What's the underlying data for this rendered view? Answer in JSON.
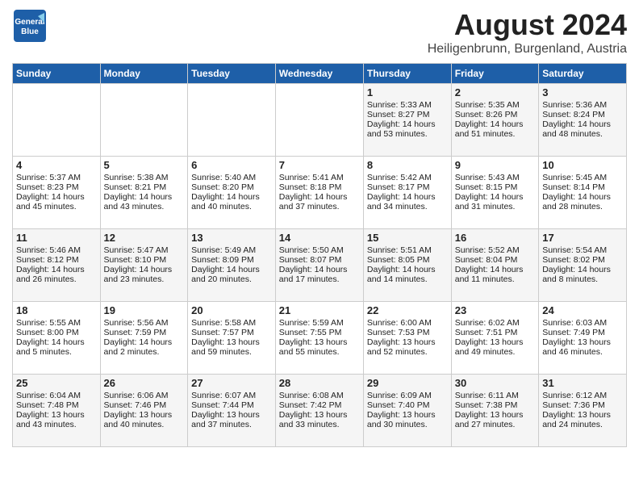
{
  "header": {
    "logo_line1": "General",
    "logo_line2": "Blue",
    "title": "August 2024",
    "subtitle": "Heiligenbrunn, Burgenland, Austria"
  },
  "weekdays": [
    "Sunday",
    "Monday",
    "Tuesday",
    "Wednesday",
    "Thursday",
    "Friday",
    "Saturday"
  ],
  "weeks": [
    [
      {
        "day": "",
        "info": ""
      },
      {
        "day": "",
        "info": ""
      },
      {
        "day": "",
        "info": ""
      },
      {
        "day": "",
        "info": ""
      },
      {
        "day": "1",
        "info": "Sunrise: 5:33 AM\nSunset: 8:27 PM\nDaylight: 14 hours\nand 53 minutes."
      },
      {
        "day": "2",
        "info": "Sunrise: 5:35 AM\nSunset: 8:26 PM\nDaylight: 14 hours\nand 51 minutes."
      },
      {
        "day": "3",
        "info": "Sunrise: 5:36 AM\nSunset: 8:24 PM\nDaylight: 14 hours\nand 48 minutes."
      }
    ],
    [
      {
        "day": "4",
        "info": "Sunrise: 5:37 AM\nSunset: 8:23 PM\nDaylight: 14 hours\nand 45 minutes."
      },
      {
        "day": "5",
        "info": "Sunrise: 5:38 AM\nSunset: 8:21 PM\nDaylight: 14 hours\nand 43 minutes."
      },
      {
        "day": "6",
        "info": "Sunrise: 5:40 AM\nSunset: 8:20 PM\nDaylight: 14 hours\nand 40 minutes."
      },
      {
        "day": "7",
        "info": "Sunrise: 5:41 AM\nSunset: 8:18 PM\nDaylight: 14 hours\nand 37 minutes."
      },
      {
        "day": "8",
        "info": "Sunrise: 5:42 AM\nSunset: 8:17 PM\nDaylight: 14 hours\nand 34 minutes."
      },
      {
        "day": "9",
        "info": "Sunrise: 5:43 AM\nSunset: 8:15 PM\nDaylight: 14 hours\nand 31 minutes."
      },
      {
        "day": "10",
        "info": "Sunrise: 5:45 AM\nSunset: 8:14 PM\nDaylight: 14 hours\nand 28 minutes."
      }
    ],
    [
      {
        "day": "11",
        "info": "Sunrise: 5:46 AM\nSunset: 8:12 PM\nDaylight: 14 hours\nand 26 minutes."
      },
      {
        "day": "12",
        "info": "Sunrise: 5:47 AM\nSunset: 8:10 PM\nDaylight: 14 hours\nand 23 minutes."
      },
      {
        "day": "13",
        "info": "Sunrise: 5:49 AM\nSunset: 8:09 PM\nDaylight: 14 hours\nand 20 minutes."
      },
      {
        "day": "14",
        "info": "Sunrise: 5:50 AM\nSunset: 8:07 PM\nDaylight: 14 hours\nand 17 minutes."
      },
      {
        "day": "15",
        "info": "Sunrise: 5:51 AM\nSunset: 8:05 PM\nDaylight: 14 hours\nand 14 minutes."
      },
      {
        "day": "16",
        "info": "Sunrise: 5:52 AM\nSunset: 8:04 PM\nDaylight: 14 hours\nand 11 minutes."
      },
      {
        "day": "17",
        "info": "Sunrise: 5:54 AM\nSunset: 8:02 PM\nDaylight: 14 hours\nand 8 minutes."
      }
    ],
    [
      {
        "day": "18",
        "info": "Sunrise: 5:55 AM\nSunset: 8:00 PM\nDaylight: 14 hours\nand 5 minutes."
      },
      {
        "day": "19",
        "info": "Sunrise: 5:56 AM\nSunset: 7:59 PM\nDaylight: 14 hours\nand 2 minutes."
      },
      {
        "day": "20",
        "info": "Sunrise: 5:58 AM\nSunset: 7:57 PM\nDaylight: 13 hours\nand 59 minutes."
      },
      {
        "day": "21",
        "info": "Sunrise: 5:59 AM\nSunset: 7:55 PM\nDaylight: 13 hours\nand 55 minutes."
      },
      {
        "day": "22",
        "info": "Sunrise: 6:00 AM\nSunset: 7:53 PM\nDaylight: 13 hours\nand 52 minutes."
      },
      {
        "day": "23",
        "info": "Sunrise: 6:02 AM\nSunset: 7:51 PM\nDaylight: 13 hours\nand 49 minutes."
      },
      {
        "day": "24",
        "info": "Sunrise: 6:03 AM\nSunset: 7:49 PM\nDaylight: 13 hours\nand 46 minutes."
      }
    ],
    [
      {
        "day": "25",
        "info": "Sunrise: 6:04 AM\nSunset: 7:48 PM\nDaylight: 13 hours\nand 43 minutes."
      },
      {
        "day": "26",
        "info": "Sunrise: 6:06 AM\nSunset: 7:46 PM\nDaylight: 13 hours\nand 40 minutes."
      },
      {
        "day": "27",
        "info": "Sunrise: 6:07 AM\nSunset: 7:44 PM\nDaylight: 13 hours\nand 37 minutes."
      },
      {
        "day": "28",
        "info": "Sunrise: 6:08 AM\nSunset: 7:42 PM\nDaylight: 13 hours\nand 33 minutes."
      },
      {
        "day": "29",
        "info": "Sunrise: 6:09 AM\nSunset: 7:40 PM\nDaylight: 13 hours\nand 30 minutes."
      },
      {
        "day": "30",
        "info": "Sunrise: 6:11 AM\nSunset: 7:38 PM\nDaylight: 13 hours\nand 27 minutes."
      },
      {
        "day": "31",
        "info": "Sunrise: 6:12 AM\nSunset: 7:36 PM\nDaylight: 13 hours\nand 24 minutes."
      }
    ]
  ]
}
